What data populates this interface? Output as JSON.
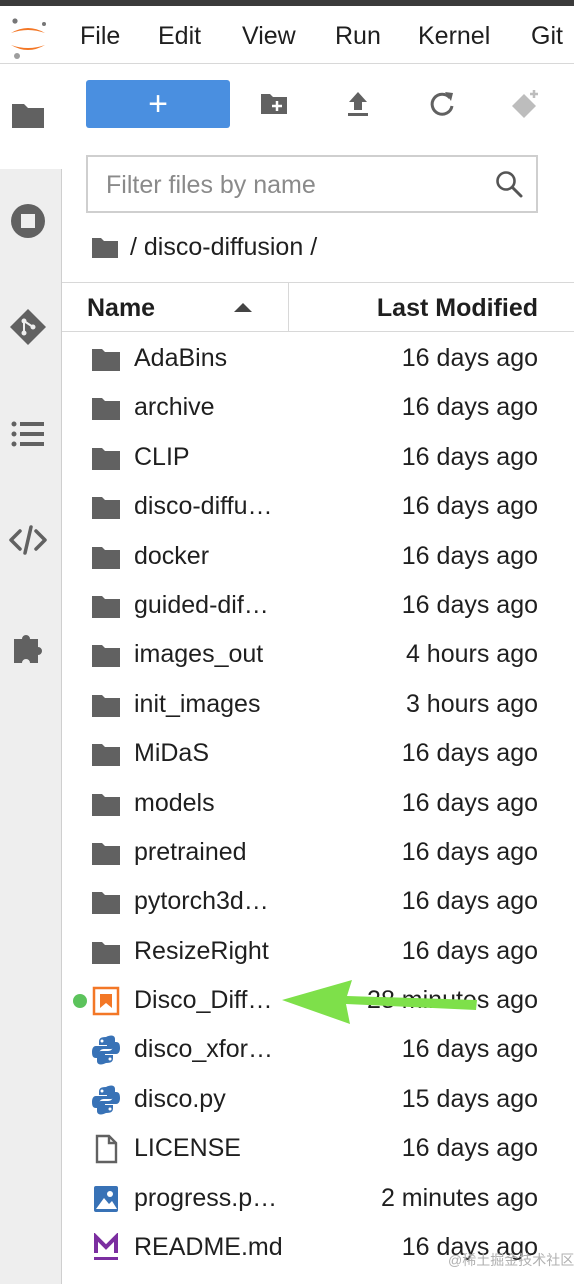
{
  "menubar": {
    "items": [
      "File",
      "Edit",
      "View",
      "Run",
      "Kernel",
      "Git"
    ]
  },
  "leftbar": {
    "icons": [
      "folder-icon",
      "stop-circle-icon",
      "git-icon",
      "list-icon",
      "code-icon",
      "puzzle-icon"
    ]
  },
  "toolbar": {
    "new_label": "+",
    "icons": [
      "new-folder-icon",
      "upload-icon",
      "refresh-icon",
      "git-clone-icon"
    ]
  },
  "filter": {
    "placeholder": "Filter files by name"
  },
  "breadcrumb": {
    "path": "/ disco-diffusion /"
  },
  "columns": {
    "name": "Name",
    "modified": "Last Modified"
  },
  "files": [
    {
      "name": "AdaBins",
      "modified": "16 days ago",
      "type": "folder"
    },
    {
      "name": "archive",
      "modified": "16 days ago",
      "type": "folder"
    },
    {
      "name": "CLIP",
      "modified": "16 days ago",
      "type": "folder"
    },
    {
      "name": "disco-diffu…",
      "modified": "16 days ago",
      "type": "folder"
    },
    {
      "name": "docker",
      "modified": "16 days ago",
      "type": "folder"
    },
    {
      "name": "guided-dif…",
      "modified": "16 days ago",
      "type": "folder"
    },
    {
      "name": "images_out",
      "modified": "4 hours ago",
      "type": "folder"
    },
    {
      "name": "init_images",
      "modified": "3 hours ago",
      "type": "folder"
    },
    {
      "name": "MiDaS",
      "modified": "16 days ago",
      "type": "folder"
    },
    {
      "name": "models",
      "modified": "16 days ago",
      "type": "folder"
    },
    {
      "name": "pretrained",
      "modified": "16 days ago",
      "type": "folder"
    },
    {
      "name": "pytorch3d…",
      "modified": "16 days ago",
      "type": "folder"
    },
    {
      "name": "ResizeRight",
      "modified": "16 days ago",
      "type": "folder"
    },
    {
      "name": "Disco_Diff…",
      "modified": "28 minutes ago",
      "type": "notebook",
      "running": true
    },
    {
      "name": "disco_xfor…",
      "modified": "16 days ago",
      "type": "python"
    },
    {
      "name": "disco.py",
      "modified": "15 days ago",
      "type": "python"
    },
    {
      "name": "LICENSE",
      "modified": "16 days ago",
      "type": "file"
    },
    {
      "name": "progress.p…",
      "modified": "2 minutes ago",
      "type": "image"
    },
    {
      "name": "README.md",
      "modified": "16 days ago",
      "type": "markdown"
    }
  ],
  "watermark": "@稀土掘金技术社区",
  "colors": {
    "accent": "#4a8fe0",
    "running": "#5cc35c",
    "arrow": "#7ee04a",
    "folder": "#616161",
    "notebook": "#f37726",
    "markdown": "#7b2ea0"
  }
}
